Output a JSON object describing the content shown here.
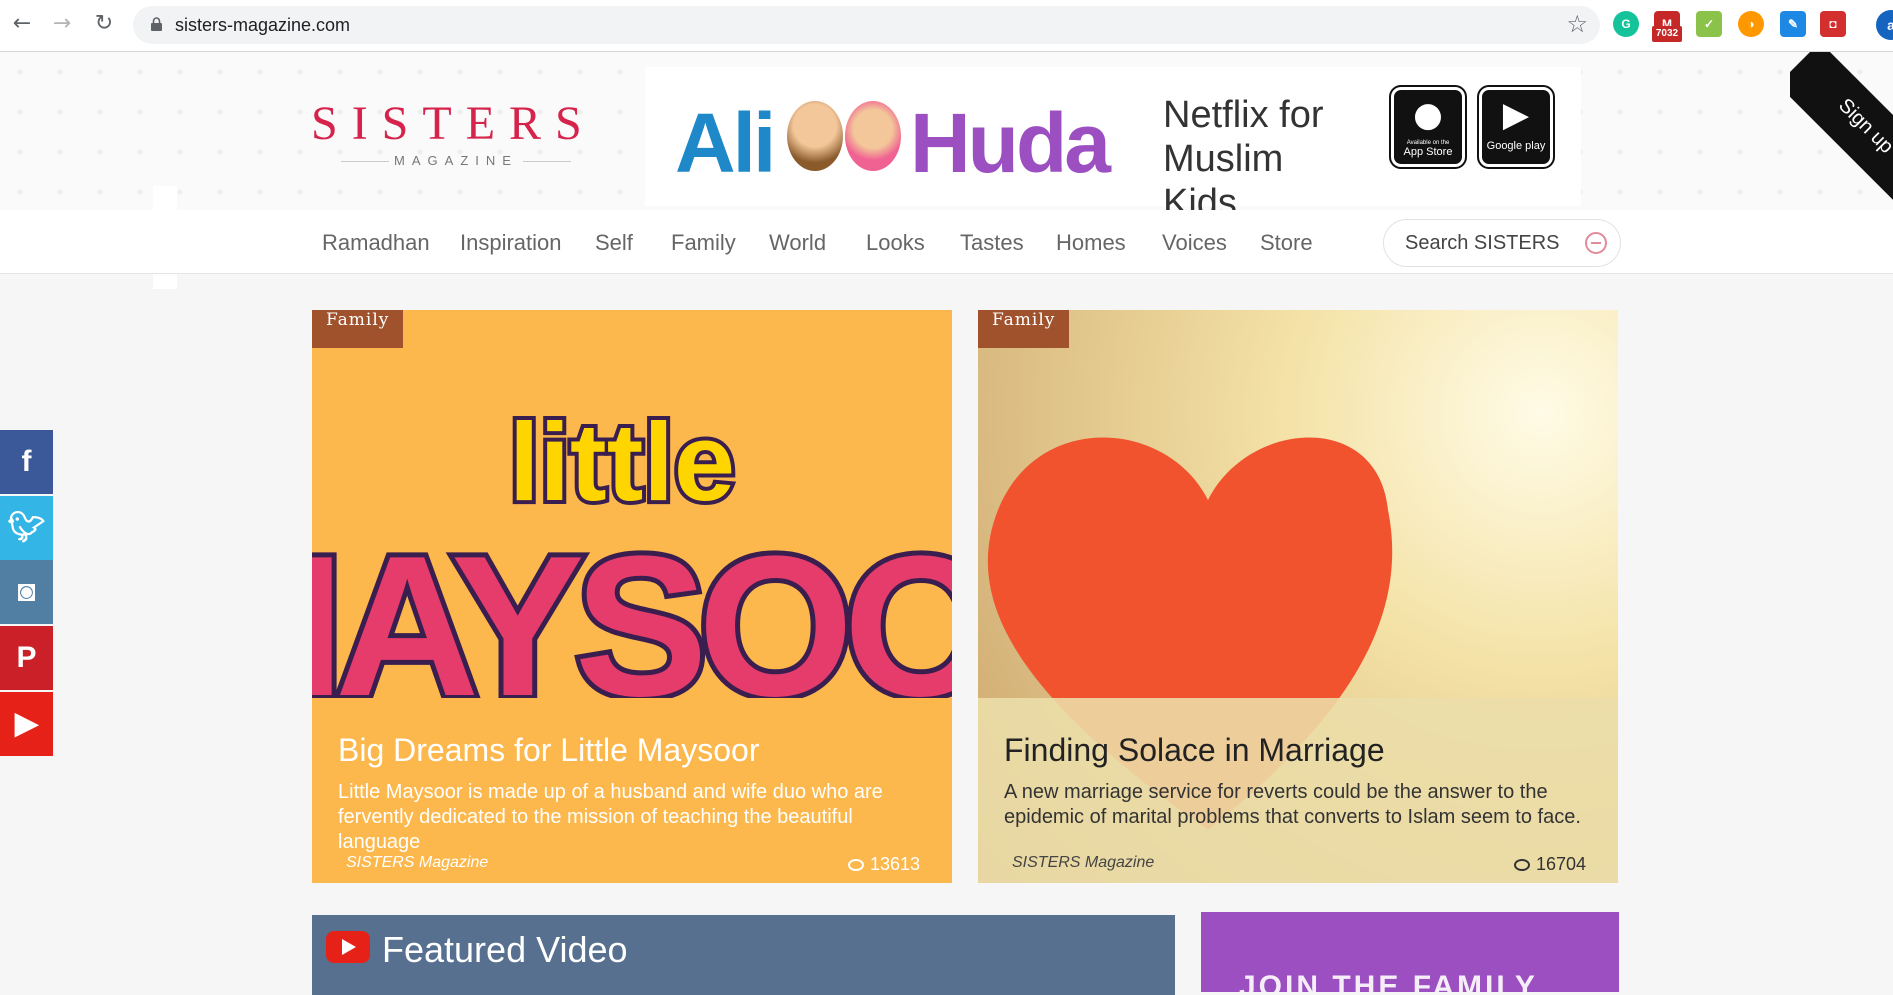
{
  "browser": {
    "url": "sisters-magazine.com",
    "mail_badge": "7032",
    "profile_initial": "a"
  },
  "logo": {
    "main": "SISTERS",
    "sub": "MAGAZINE"
  },
  "banner": {
    "left_name": "Ali",
    "right_name": "Huda",
    "tagline": "Netflix for Muslim Kids",
    "app_store": "App Store",
    "app_store_caption": "Available on the",
    "google_play": "Google play"
  },
  "corner": {
    "label": "Sign up"
  },
  "nav": {
    "items": [
      "Ramadhan",
      "Inspiration",
      "Self",
      "Family",
      "World",
      "Looks",
      "Tastes",
      "Homes",
      "Voices",
      "Store"
    ],
    "search_placeholder": "Search SISTERS"
  },
  "social": [
    "facebook-icon",
    "twitter-icon",
    "instagram-icon",
    "pinterest-icon",
    "youtube-icon"
  ],
  "articles": [
    {
      "category": "Family",
      "title": "Big Dreams for Little Maysoor",
      "desc": "Little Maysoor is made up of a husband and wife duo who are fervently dedicated to the mission of teaching the beautiful language",
      "author": "SISTERS Magazine",
      "views": "13613",
      "image_text_top": "little",
      "image_text_bottom": "MAYSOO!"
    },
    {
      "category": "Family",
      "title": "Finding Solace in Marriage",
      "desc": "A new marriage service for reverts could be the answer to the epidemic of marital problems that converts to Islam seem to face.",
      "author": "SISTERS Magazine",
      "views": "16704"
    }
  ],
  "featured": {
    "label": "Featured Video"
  },
  "join": {
    "label": "JOIN THE FAMILY"
  },
  "colors": {
    "brand": "#d6234c",
    "tag": "#a0522d",
    "card1_bg": "#fcb84c",
    "join": "#9c4fc0"
  }
}
